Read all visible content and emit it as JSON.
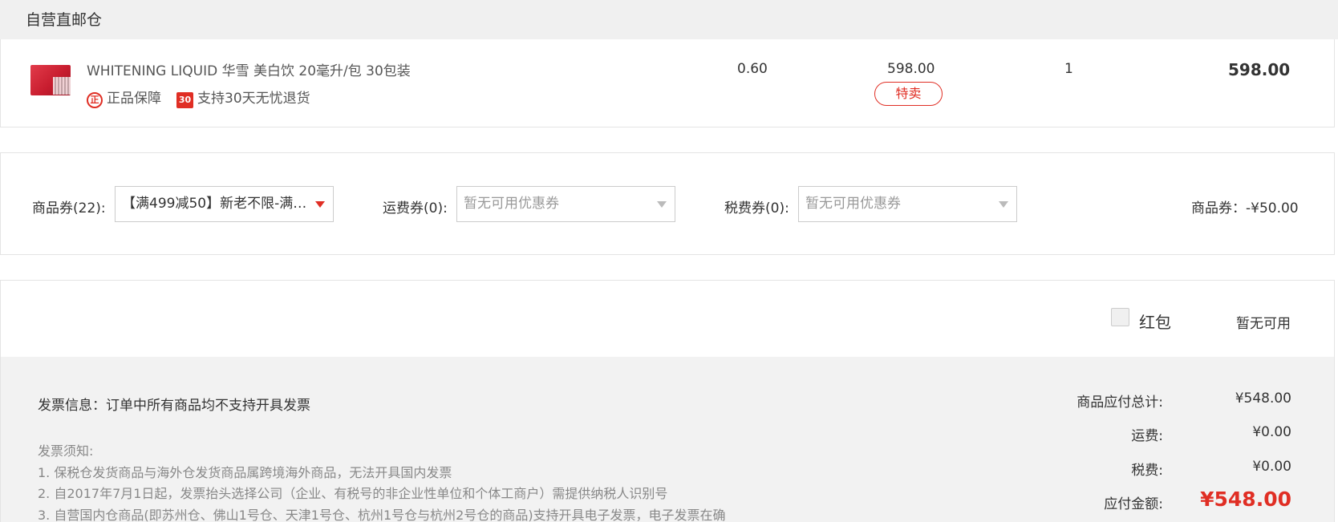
{
  "warehouse": {
    "title": "自营直邮仓"
  },
  "product": {
    "name": "WHITENING LIQUID 华雪 美白饮 20毫升/包 30包装",
    "guarantee_icon": "正",
    "guarantee_text": "正品保障",
    "refund_icon": "30",
    "refund_text": "支持30天无忧退货",
    "tax": "0.60",
    "unit_price": "598.00",
    "sale_tag": "特卖",
    "quantity": "1",
    "subtotal": "598.00"
  },
  "coupons": {
    "product_coupon": {
      "label": "商品券(22):",
      "value": "【满499减50】新老不限-满…"
    },
    "shipping_coupon": {
      "label": "运费券(0):",
      "value": "暂无可用优惠券"
    },
    "tax_coupon": {
      "label": "税费券(0):",
      "value": "暂无可用优惠券"
    },
    "discount_summary": "商品券：-¥50.00"
  },
  "red_packet": {
    "label": "红包",
    "status": "暂无可用"
  },
  "invoice": {
    "info": "发票信息：订单中所有商品均不支持开具发票",
    "notes_title": "发票须知:",
    "notes": [
      "1. 保税仓发货商品与海外仓发货商品属跨境海外商品，无法开具国内发票",
      "2. 自2017年7月1日起，发票抬头选择公司（企业、有税号的非企业性单位和个体工商户）需提供纳税人识别号",
      "3. 自营国内仓商品(即苏州仓、佛山1号仓、天津1号仓、杭州1号仓与杭州2号仓的商品)支持开具电子发票，电子发票在确"
    ]
  },
  "summary": {
    "goods_total_label": "商品应付总计:",
    "goods_total": "¥548.00",
    "shipping_label": "运费:",
    "shipping": "¥0.00",
    "tax_label": "税费:",
    "tax": "¥0.00",
    "payable_label": "应付金额:",
    "payable": "¥548.00"
  },
  "colors": {
    "accent": "#e02e24",
    "panel_bg": "#f2f2f2",
    "border": "#e4e4e4"
  }
}
